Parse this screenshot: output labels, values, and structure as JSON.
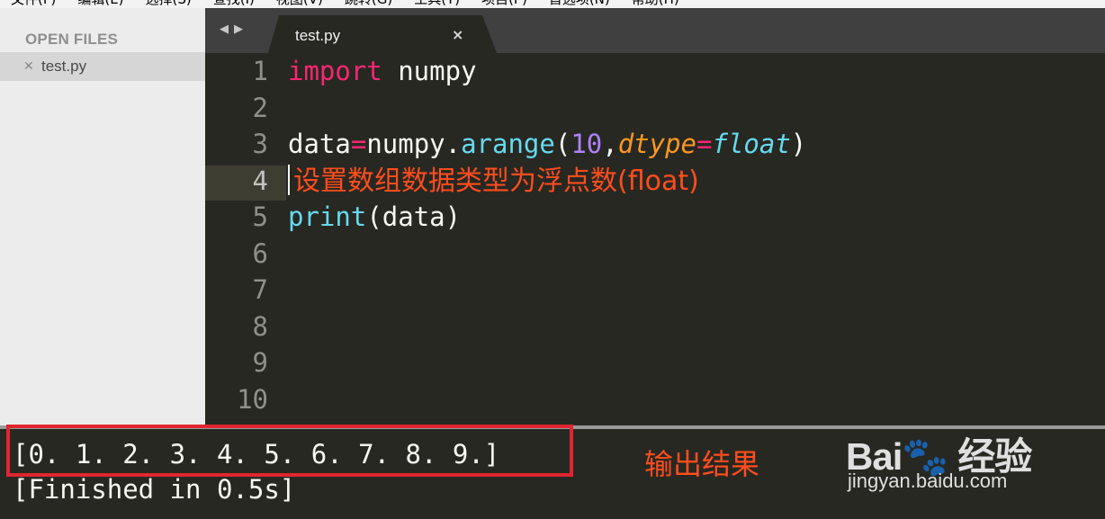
{
  "menu": {
    "items": [
      "文件(F)",
      "编辑(E)",
      "选择(S)",
      "查找(I)",
      "视图(V)",
      "跳转(G)",
      "工具(T)",
      "项目(P)",
      "首选项(N)",
      "帮助(H)"
    ]
  },
  "sidebar": {
    "heading": "OPEN FILES",
    "files": [
      {
        "name": "test.py"
      }
    ]
  },
  "tabs": {
    "nav_left": "◀",
    "nav_right": "▶",
    "active": {
      "title": "test.py",
      "close": "×"
    }
  },
  "editor": {
    "line_numbers": [
      "1",
      "2",
      "3",
      "4",
      "5",
      "6",
      "7",
      "8",
      "9",
      "10"
    ],
    "active_line": "4",
    "code": {
      "l1_kw": "import",
      "l1_rest": " numpy",
      "l3_a": "data",
      "l3_eq": "=",
      "l3_b": "numpy.",
      "l3_fn": "arange",
      "l3_open": "(",
      "l3_num": "10",
      "l3_comma": ",",
      "l3_param": "dtype",
      "l3_eq2": "=",
      "l3_builtin": "float",
      "l3_close": ")",
      "l4_annotation": "设置数组数据类型为浮点数(float)",
      "l5_fn": "print",
      "l5_rest": "(data)"
    }
  },
  "output": {
    "line1": "[0. 1. 2. 3. 4. 5. 6. 7. 8. 9.]",
    "line2": "[Finished in 0.5s]",
    "annotation": "输出结果"
  },
  "watermark": {
    "logo": "Bai🐾 经验",
    "url": "jingyan.baidu.com"
  },
  "colors": {
    "editor_bg": "#272822",
    "keyword": "#f92672",
    "function": "#66d9ef",
    "number": "#ae81ff",
    "param": "#fd971f",
    "annotation": "#ff4d1c",
    "highlight_box": "#e02630"
  }
}
